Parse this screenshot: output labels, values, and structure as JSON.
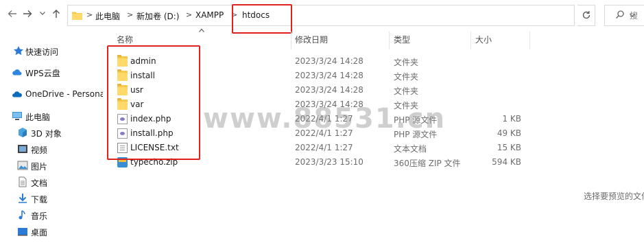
{
  "toolbar": {
    "back_icon": "arrow-left-icon",
    "forward_icon": "arrow-right-icon",
    "recent_icon": "chevron-down-icon",
    "up_icon": "arrow-up-icon",
    "refresh_icon": "refresh-icon",
    "search_icon": "search-icon",
    "search_text": "搜"
  },
  "address": {
    "breadcrumbs": [
      "此电脑",
      "新加卷 (D:)",
      "XAMPP",
      "htdocs"
    ],
    "separator": ">",
    "dropdown_icon": "chevron-down-icon"
  },
  "columns": {
    "name": "名称",
    "modified": "修改日期",
    "type": "类型",
    "size": "大小",
    "sort_indicator": "^"
  },
  "sidebar": {
    "items": [
      {
        "label": "快速访问",
        "icon": "star-icon"
      },
      {
        "label": "WPS云盘",
        "icon": "cloud-icon"
      },
      {
        "label": "OneDrive - Persona",
        "icon": "onedrive-icon"
      },
      {
        "label": "此电脑",
        "icon": "computer-icon"
      },
      {
        "label": "3D 对象",
        "icon": "cube-icon"
      },
      {
        "label": "视频",
        "icon": "video-icon"
      },
      {
        "label": "图片",
        "icon": "picture-icon"
      },
      {
        "label": "文档",
        "icon": "document-icon"
      },
      {
        "label": "下载",
        "icon": "download-icon"
      },
      {
        "label": "音乐",
        "icon": "music-icon"
      },
      {
        "label": "桌面",
        "icon": "desktop-icon"
      }
    ]
  },
  "files": [
    {
      "name": "admin",
      "date": "2023/3/24 14:28",
      "type": "文件夹",
      "size": "",
      "icon": "folder-icon"
    },
    {
      "name": "install",
      "date": "2023/3/24 14:28",
      "type": "文件夹",
      "size": "",
      "icon": "folder-icon"
    },
    {
      "name": "usr",
      "date": "2023/3/24 14:28",
      "type": "文件夹",
      "size": "",
      "icon": "folder-icon"
    },
    {
      "name": "var",
      "date": "2023/3/24 14:28",
      "type": "文件夹",
      "size": "",
      "icon": "folder-icon"
    },
    {
      "name": "index.php",
      "date": "2022/4/1 1:27",
      "type": "PHP 源文件",
      "size": "1 KB",
      "icon": "php-file-icon"
    },
    {
      "name": "install.php",
      "date": "2022/4/1 1:27",
      "type": "PHP 源文件",
      "size": "49 KB",
      "icon": "php-file-icon"
    },
    {
      "name": "LICENSE.txt",
      "date": "2022/4/1 1:27",
      "type": "文本文档",
      "size": "15 KB",
      "icon": "text-file-icon"
    },
    {
      "name": "typecho.zip",
      "date": "2023/3/23 15:10",
      "type": "360压缩 ZIP 文件",
      "size": "594 KB",
      "icon": "zip-file-icon"
    }
  ],
  "preview_pane": {
    "hint": "选择要预览的文件"
  },
  "watermark": "www.88531.cn",
  "colors": {
    "highlight_box": "#e0211e",
    "folder": "#f6c84c",
    "secondary_text": "#6d6d6d"
  }
}
